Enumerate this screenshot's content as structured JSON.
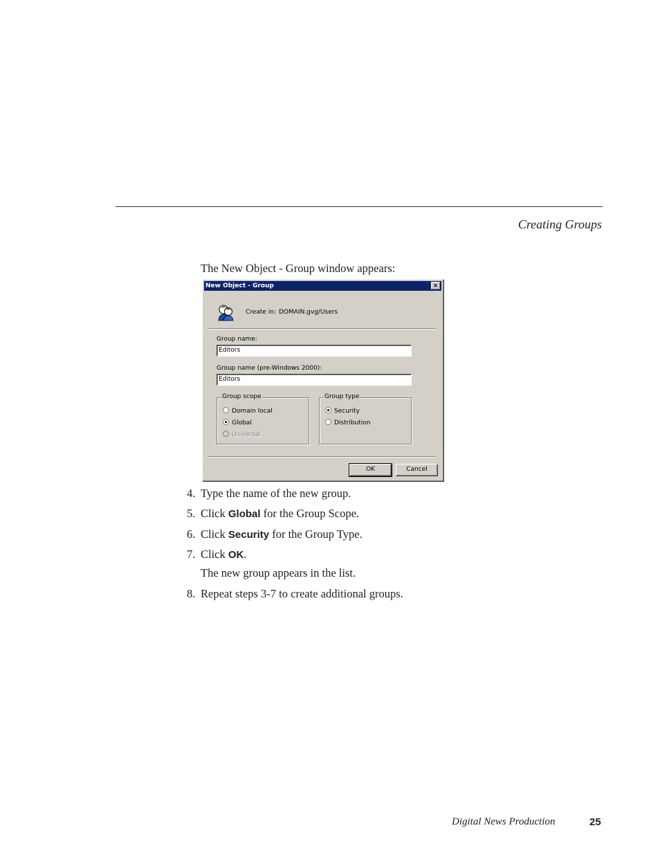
{
  "header": {
    "section_title": "Creating Groups"
  },
  "intro": "The New Object - Group window appears:",
  "dialog": {
    "title": "New Object - Group",
    "close_glyph": "×",
    "create_in_label": "Create in:",
    "create_in_path": "DOMAIN.gvg/Users",
    "group_name_label": "Group name:",
    "group_name_value": "Editors",
    "group_name_pre2000_label": "Group name (pre-Windows 2000):",
    "group_name_pre2000_value": "Editors",
    "group_scope": {
      "title": "Group scope",
      "options": [
        {
          "label": "Domain local",
          "selected": false,
          "enabled": true
        },
        {
          "label": "Global",
          "selected": true,
          "enabled": true
        },
        {
          "label": "Universal",
          "selected": false,
          "enabled": false
        }
      ]
    },
    "group_type": {
      "title": "Group type",
      "options": [
        {
          "label": "Security",
          "selected": true,
          "enabled": true
        },
        {
          "label": "Distribution",
          "selected": false,
          "enabled": true
        }
      ]
    },
    "ok_label": "OK",
    "cancel_label": "Cancel"
  },
  "steps": [
    {
      "num": "4.",
      "pre": "Type the name of the new group.",
      "bold": "",
      "post": ""
    },
    {
      "num": "5.",
      "pre": "Click ",
      "bold": "Global",
      "post": " for the Group Scope."
    },
    {
      "num": "6.",
      "pre": "Click ",
      "bold": "Security",
      "post": " for the Group Type."
    },
    {
      "num": "7.",
      "pre": "Click ",
      "bold": "OK",
      "post": "."
    },
    {
      "num": "8.",
      "pre": "Repeat steps 3-7 to create additional groups.",
      "bold": "",
      "post": ""
    }
  ],
  "step7_note": "The new group appears in the list.",
  "footer": {
    "book_title": "Digital News Production",
    "page_number": "25"
  }
}
